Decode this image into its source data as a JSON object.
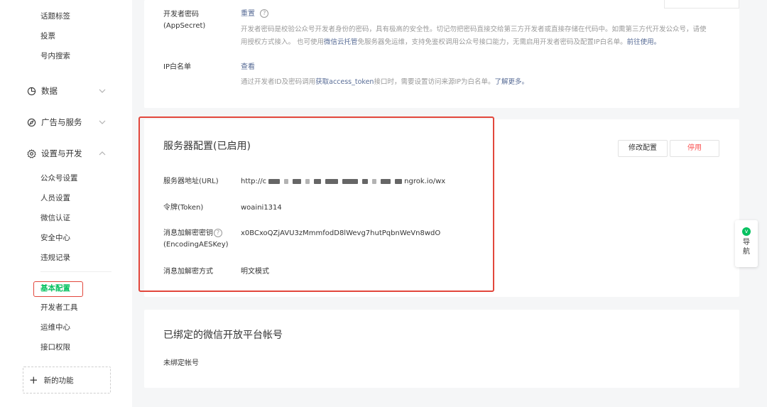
{
  "sidebar": {
    "top_items": [
      "话题标签",
      "投票",
      "号内搜索"
    ],
    "groups": {
      "data": "数据",
      "ads": "广告与服务",
      "settings": "设置与开发"
    },
    "settings_items": [
      "公众号设置",
      "人员设置",
      "微信认证",
      "安全中心",
      "违规记录"
    ],
    "dev_items": [
      "基本配置",
      "开发者工具",
      "运维中心",
      "接口权限"
    ],
    "new_feature": "新的功能"
  },
  "secret": {
    "label": "开发者密码(AppSecret)",
    "action": "重置",
    "help": "?",
    "desc_1": "开发者密码是校验公众号开发者身份的密码，具有极高的安全性。切记勿把密码直接交给第三方开发者或直接存储在代码中。如需第三方代开发公众号，请使",
    "desc_2_a": "用授权方式接入。 也可使用",
    "desc_2_link1": "微信云托管",
    "desc_2_b": "免服务器免运维，支持免鉴权调用公众号接口能力，无需启用开发者密码及配置IP白名单。",
    "desc_2_link2": "前往使用。"
  },
  "ip_whitelist": {
    "label": "IP白名单",
    "action": "查看",
    "desc_a": "通过开发者ID及密码调用",
    "desc_link1": "获取access_token",
    "desc_b": "接口时，需要设置访问来源IP为白名单。",
    "desc_link2": "了解更多。"
  },
  "server_config": {
    "title": "服务器配置(已启用)",
    "edit_button": "修改配置",
    "stop_button": "停用",
    "url_label": "服务器地址(URL)",
    "url_prefix": "http://c",
    "url_suffix": "ngrok.io/wx",
    "token_label": "令牌(Token)",
    "token_value": "woaini1314",
    "aes_label_1": "消息加解密密钥",
    "aes_label_2": "(EncodingAESKey)",
    "aes_value": "x0BCxoQZjAVU3zMmmfodD8lWevg7hutPqbnWeVn8wdO",
    "mode_label": "消息加解密方式",
    "mode_value": "明文模式",
    "help": "?"
  },
  "open_platform": {
    "title": "已绑定的微信开放平台帐号",
    "status": "未绑定帐号"
  },
  "nav_float": {
    "char1": "导",
    "char2": "航",
    "icon_glyph": "v"
  },
  "colors": {
    "accent": "#07c160",
    "link": "#576b95",
    "danger": "#fa5151",
    "highlight": "#e2473c"
  }
}
